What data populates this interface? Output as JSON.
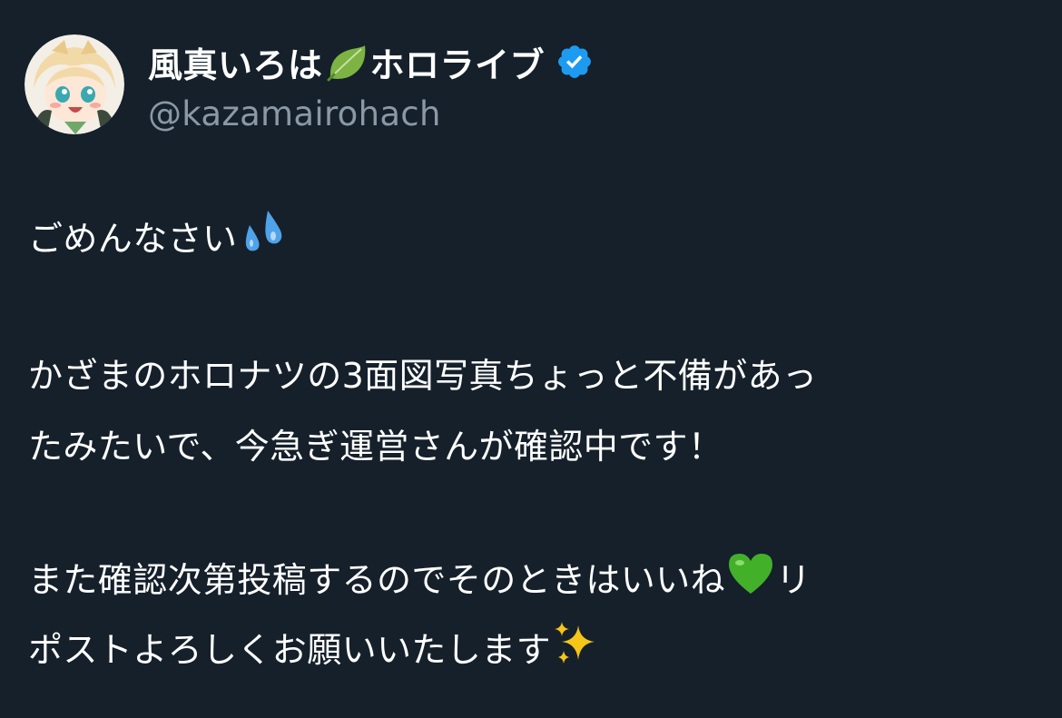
{
  "tweet": {
    "display_name_part1": "風真いろは",
    "display_name_part2": "ホロライブ",
    "handle": "@kazamairohach",
    "line1": "ごめんなさい",
    "line2": "かざまのホロナツの3面図写真ちょっと不備があっ",
    "line3": "たみたいで、今急ぎ運営さんが確認中です！",
    "line4a": "また確認次第投稿するのでそのときはいいね",
    "line4b": "リ",
    "line5": "ポストよろしくお願いいたします"
  },
  "icons": {
    "leaf": "leaf-emoji-icon",
    "verified": "verified-badge-icon",
    "droplets": "sweat-droplets-icon",
    "heart": "green-heart-icon",
    "sparkles": "sparkles-icon"
  },
  "colors": {
    "background": "#15202b",
    "text": "#ffffff",
    "handle": "#8b98a5",
    "verified": "#1d9bf0"
  }
}
